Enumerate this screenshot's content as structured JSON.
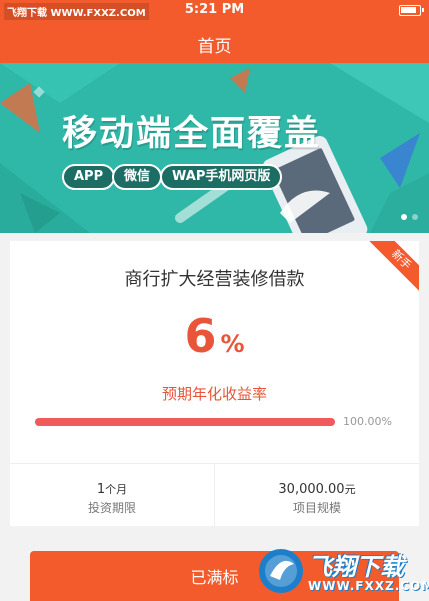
{
  "status_bar": {
    "watermark_label": "飞翔下载 WWW.FXXZ.COM",
    "time": "5:21 PM",
    "battery_icon": "battery-icon"
  },
  "nav": {
    "title": "首页"
  },
  "banner": {
    "title": "移动端全面覆盖",
    "tags": [
      "APP",
      "微信",
      "WAP手机网页版"
    ],
    "colors": {
      "background": "#2fb8a8",
      "pill_background": "#1c6e64"
    },
    "active_slide": 1,
    "slide_count": 2
  },
  "product": {
    "badge": "新手",
    "name": "商行扩大经营装修借款",
    "rate_value": "6",
    "rate_unit": "%",
    "rate_label": "预期年化收益率",
    "progress_percent": 100,
    "progress_text": "100.00%",
    "stats": [
      {
        "value": "1",
        "unit": "个月",
        "label": "投资期限"
      },
      {
        "value": "30,000.00",
        "unit": "元",
        "label": "项目规模"
      }
    ]
  },
  "action": {
    "button_label": "已满标"
  },
  "watermark": {
    "text": "飞翔下载",
    "url": "WWW.FXXZ.COM",
    "icon": "fxxz-logo-icon"
  },
  "colors": {
    "accent": "#f35a2c",
    "rate_red": "#e8553a",
    "progress": "#f05a5a"
  }
}
